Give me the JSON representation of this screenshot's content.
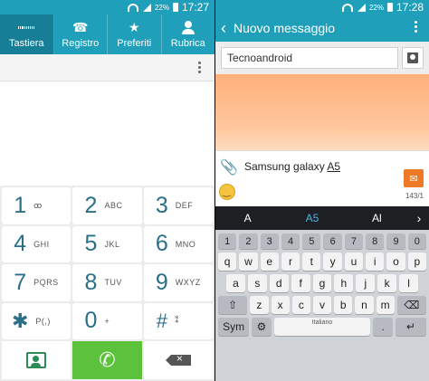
{
  "left_status": {
    "battery_pct": "22%",
    "time": "17:27"
  },
  "right_status": {
    "battery_pct": "22%",
    "time": "17:28"
  },
  "phone_tabs": [
    {
      "label": "Tastiera",
      "icon": "keypad-icon",
      "active": true
    },
    {
      "label": "Registro",
      "icon": "call-log-icon",
      "active": false
    },
    {
      "label": "Preferiti",
      "icon": "star-icon",
      "active": false
    },
    {
      "label": "Rubrica",
      "icon": "contacts-icon",
      "active": false
    }
  ],
  "dial_keys": [
    {
      "num": "1",
      "sub": "ꝏ"
    },
    {
      "num": "2",
      "sub": "ABC"
    },
    {
      "num": "3",
      "sub": "DEF"
    },
    {
      "num": "4",
      "sub": "GHI"
    },
    {
      "num": "5",
      "sub": "JKL"
    },
    {
      "num": "6",
      "sub": "MNO"
    },
    {
      "num": "7",
      "sub": "PQRS"
    },
    {
      "num": "8",
      "sub": "TUV"
    },
    {
      "num": "9",
      "sub": "WXYZ"
    },
    {
      "num": "✱",
      "sub": "P(,)"
    },
    {
      "num": "0",
      "sub": "+"
    },
    {
      "num": "#",
      "sub": "⁑"
    }
  ],
  "message": {
    "title": "Nuovo messaggio",
    "recipient": "Tecnoandroid",
    "text_prefix": "Samsung galaxy ",
    "text_underlined": "A5",
    "char_counter": "143/1"
  },
  "keyboard": {
    "suggestions": [
      "A",
      "A5",
      "Al"
    ],
    "number_row": [
      "1",
      "2",
      "3",
      "4",
      "5",
      "6",
      "7",
      "8",
      "9",
      "0"
    ],
    "row1": [
      "q",
      "w",
      "e",
      "r",
      "t",
      "y",
      "u",
      "i",
      "o",
      "p"
    ],
    "row2": [
      "a",
      "s",
      "d",
      "f",
      "g",
      "h",
      "j",
      "k",
      "l"
    ],
    "row3": [
      "z",
      "x",
      "c",
      "v",
      "b",
      "n",
      "m"
    ],
    "sym_label": "Sym",
    "space_label": "Italiano",
    "enter_label": "↵",
    "shift_label": "⇧",
    "backspace_label": "⌫",
    "period_label": ".",
    "settings_label": "⚙"
  },
  "colors": {
    "accent": "#1f9fba",
    "call_green": "#5cc13b",
    "send_orange": "#ef7a25"
  }
}
